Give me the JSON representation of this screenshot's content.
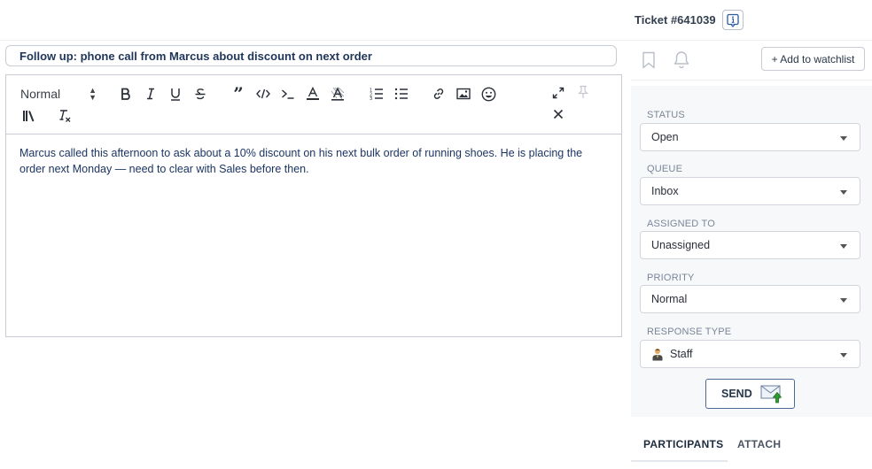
{
  "header": {
    "ticket_id": "Ticket #641039"
  },
  "subject": {
    "value": "Follow up: phone call from Marcus about discount on next order"
  },
  "editor": {
    "format_select": "Normal",
    "body": "Marcus called this afternoon to ask about a 10% discount on his next bulk order of running shoes. He is placing the order next Monday — need to clear with Sales before then."
  },
  "watch": {
    "add_label": "+ Add to watchlist"
  },
  "props": {
    "status": {
      "label": "STATUS",
      "value": "Open"
    },
    "queue": {
      "label": "QUEUE",
      "value": "Inbox"
    },
    "assigned": {
      "label": "ASSIGNED TO",
      "value": "Unassigned"
    },
    "priority": {
      "label": "PRIORITY",
      "value": "Normal"
    },
    "response": {
      "label": "RESPONSE TYPE",
      "value": "Staff"
    }
  },
  "send": {
    "label": "SEND"
  },
  "tabs": [
    {
      "label": "PARTICIPANTS"
    },
    {
      "label": "ATTACH"
    }
  ],
  "colors": {
    "text_primary": "#1b3563",
    "panel_bg": "#f7f8fa",
    "send_arrow": "#2e9e2e"
  },
  "icons": [
    "info-icon",
    "bookmark-icon",
    "bell-icon",
    "bold-icon",
    "italic-icon",
    "underline-icon",
    "strikethrough-icon",
    "quote-icon",
    "code-icon",
    "code-block-icon",
    "text-color-icon",
    "background-color-icon",
    "ordered-list-icon",
    "bullet-list-icon",
    "link-icon",
    "image-icon",
    "emoji-icon",
    "expand-icon",
    "pin-icon",
    "close-icon",
    "library-icon",
    "clear-format-icon",
    "staff-icon",
    "send-mail-icon"
  ]
}
